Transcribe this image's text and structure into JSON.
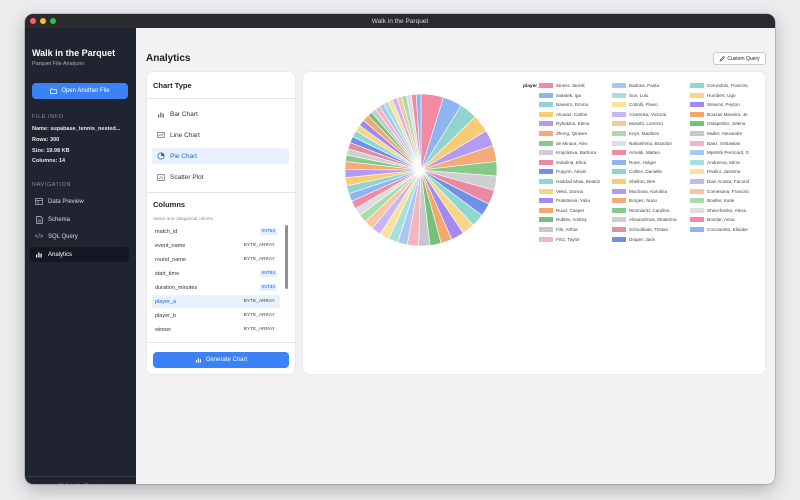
{
  "window": {
    "title": "Walk in the Parquet"
  },
  "sidebar": {
    "app_title": "Walk in the Parquet",
    "app_subtitle": "Parquet File Analyzer",
    "open_button": "Open Another File",
    "file_info_title": "FILE INFO",
    "file_info": [
      "Name: supabase_tennis_nested...",
      "Rows: 300",
      "Size: 19.98 KB",
      "Columns: 14"
    ],
    "navigation_title": "NAVIGATION",
    "nav": [
      {
        "label": "Data Preview",
        "icon": "table-icon"
      },
      {
        "label": "Schema",
        "icon": "document-icon"
      },
      {
        "label": "SQL Query",
        "icon": "code-icon"
      },
      {
        "label": "Analytics",
        "icon": "chart-icon",
        "active": true
      }
    ],
    "footer": "Walk in the Parquet"
  },
  "main": {
    "title": "Analytics",
    "custom_query": "Custom Query",
    "chart_type_title": "Chart Type",
    "chart_types": [
      {
        "label": "Bar Chart",
        "icon": "bar-chart-icon"
      },
      {
        "label": "Line Chart",
        "icon": "line-chart-icon"
      },
      {
        "label": "Pie Chart",
        "icon": "pie-chart-icon",
        "selected": true
      },
      {
        "label": "Scatter Plot",
        "icon": "scatter-plot-icon"
      }
    ],
    "columns_title": "Columns",
    "columns_hint": "Select one categorical column",
    "columns": [
      {
        "name": "match_id",
        "type": "INT64"
      },
      {
        "name": "event_name",
        "type": "BYTE_ARRAY"
      },
      {
        "name": "round_name",
        "type": "BYTE_ARRAY"
      },
      {
        "name": "start_time",
        "type": "INT64"
      },
      {
        "name": "duration_minutes",
        "type": "INT32"
      },
      {
        "name": "player_a",
        "type": "BYTE_ARRAY",
        "selected": true
      },
      {
        "name": "player_b",
        "type": "BYTE_ARRAY"
      },
      {
        "name": "winner",
        "type": "BYTE_ARRAY"
      }
    ],
    "generate_button": "Generate Chart"
  },
  "colors": {
    "accent": "#3b82f6",
    "sidebar_bg": "#1f2430",
    "palette": [
      "#f48aa1",
      "#8fb4f2",
      "#91d3ce",
      "#f8cc76",
      "#b49af0",
      "#f5ab78",
      "#86c98a",
      "#cfcfd3",
      "#e88aa0",
      "#6f8fe8",
      "#8ed8d0",
      "#f7d58a",
      "#a38af0",
      "#f4a86e",
      "#74c27a",
      "#c8c8cc",
      "#f6b3c0",
      "#a9c6f4",
      "#a7e0da",
      "#fbe0a0",
      "#c9b4f4",
      "#f8c6a2",
      "#a9dbac",
      "#dedee2"
    ]
  },
  "chart_data": {
    "type": "pie",
    "title": "",
    "legend_title": "player_a",
    "legend_position": "right",
    "categories": [
      "Sinner, Jannik",
      "Swiatek, Iga",
      "Navarro, Emma",
      "Alcaraz, Carlos",
      "Rybakina, Elena",
      "Zheng, Qinwen",
      "de Minaur, Alex",
      "Krejcikova, Barbora",
      "Svitolina, Elina",
      "Popyrin, Alexei",
      "Haddad Maia, Beatriz",
      "Vekic, Donna",
      "Putintseva, Yulia",
      "Ruud, Casper",
      "Rublev, Andrey",
      "Fils, Arthur",
      "Fritz, Taylor",
      "Badosa, Paula",
      "Sun, Lulu",
      "Cobolli, Flavio",
      "Azarenka, Victoria",
      "Musetti, Lorenzo",
      "Keys, Madison",
      "Nakashima, Brandon",
      "Arnaldi, Matteo",
      "Rune, Holger",
      "Collins, Danielle",
      "Shelton, Ben",
      "Muchova, Karolina",
      "Borges, Nuno",
      "Wozniacki, Caroline",
      "Alexandrova, Ekaterina",
      "Schoolkate, Tristan",
      "Draper, Jack",
      "Cerundolo, Francisc",
      "Humbert, Ugo",
      "Stearns, Peyton",
      "Bouzas Maneiro, Je",
      "Ostapenko, Jelena",
      "Muller, Alexandre",
      "Baez, Sebastian",
      "Mpetshi Perricard, G",
      "Andreeva, Mirra",
      "Paolini, Jasmine",
      "Diaz Acosta, Facund",
      "Comesana, Francisc",
      "Boulter, Katie",
      "Shevchenko, Alexa",
      "Bondar, Anna",
      "Cocciaretto, Elisabe"
    ],
    "values": [
      14,
      12,
      11,
      11,
      10,
      10,
      9,
      9,
      9,
      8,
      8,
      8,
      8,
      7,
      7,
      7,
      7,
      6,
      6,
      6,
      6,
      6,
      5,
      5,
      5,
      5,
      5,
      5,
      5,
      5,
      4,
      4,
      4,
      4,
      4,
      4,
      4,
      4,
      3,
      3,
      3,
      3,
      3,
      3,
      3,
      3,
      3,
      3,
      3,
      3
    ]
  }
}
